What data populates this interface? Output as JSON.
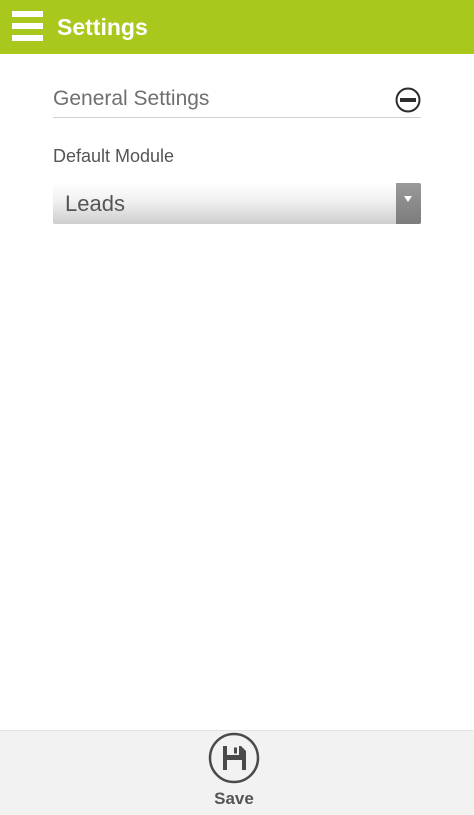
{
  "header": {
    "title": "Settings",
    "background_color": "#a8c81e",
    "menu_icon": "hamburger-menu-icon"
  },
  "general_settings": {
    "title": "General Settings",
    "toggle_icon": "collapse-minus-icon",
    "expanded": true
  },
  "default_module": {
    "label": "Default Module",
    "selected": "Leads",
    "dropdown_icon": "dropdown-triangle-icon"
  },
  "footer": {
    "save_label": "Save",
    "save_icon": "floppy-disk-icon"
  }
}
